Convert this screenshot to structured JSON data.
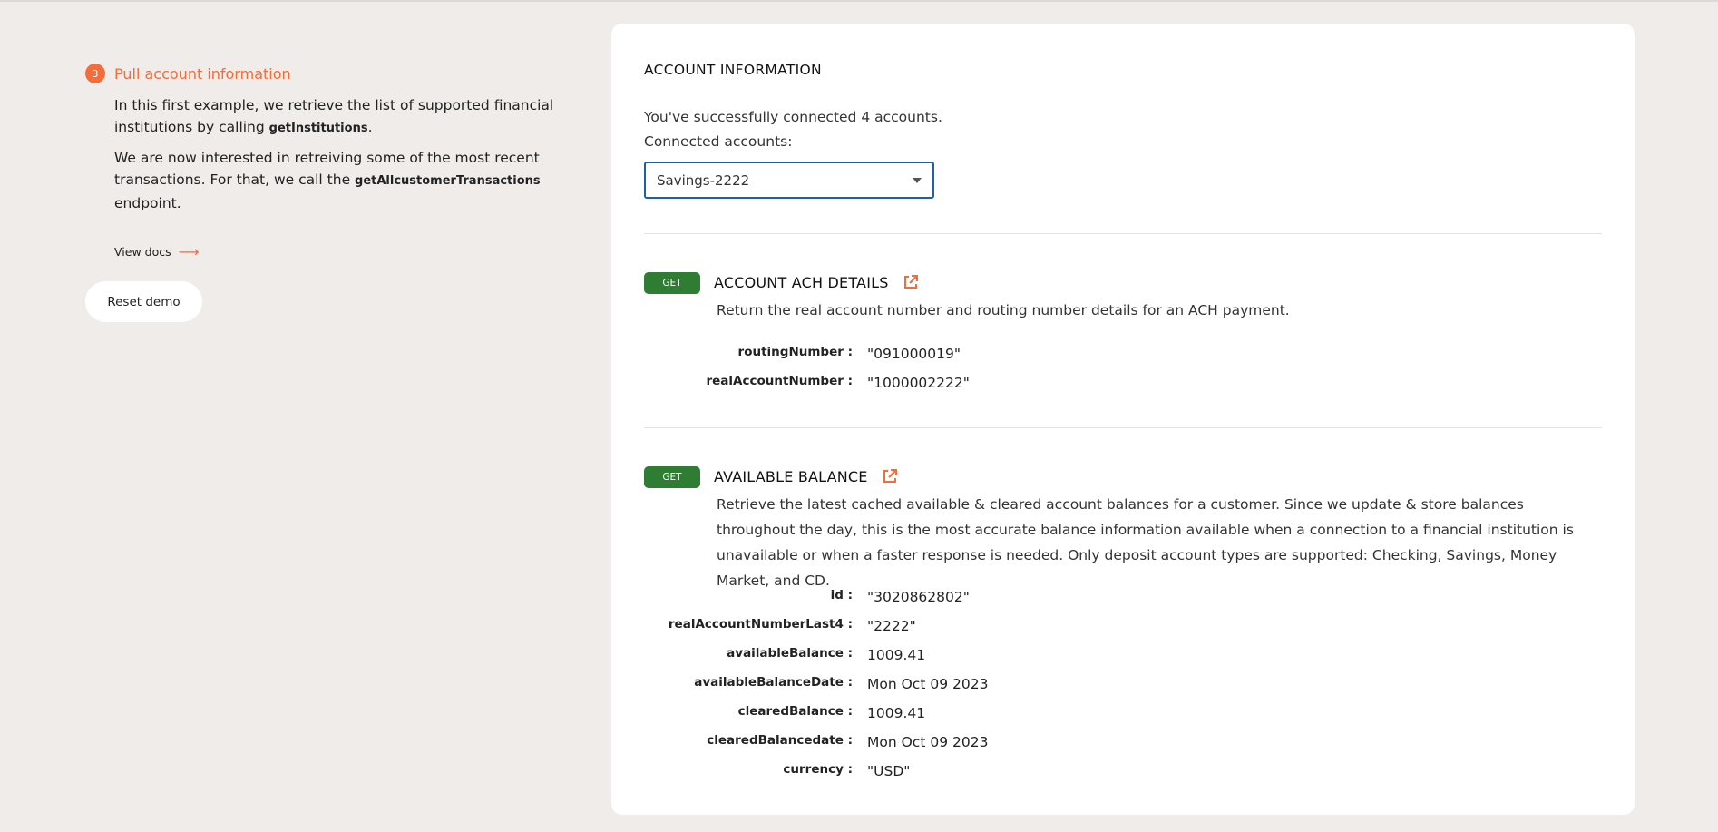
{
  "step": {
    "number": "3",
    "title": "Pull account information",
    "p1_prefix": "In this first example, we retrieve the list of supported financial institutions by calling ",
    "p1_code": "getInstitutions",
    "p1_suffix": ".",
    "p2_prefix": "We are now interested in retreiving some of the most recent transactions. For that, we call the ",
    "p2_code": "getAllcustomerTransactions",
    "p2_suffix": " endpoint.",
    "view_docs": "View docs",
    "view_docs_arrow": "⟶",
    "reset_label": "Reset demo"
  },
  "card": {
    "title": "ACCOUNT INFORMATION",
    "connected_text": "You've successfully connected 4 accounts.",
    "connected_label": "Connected accounts:",
    "selected_account": "Savings-2222"
  },
  "endpoints": [
    {
      "method": "GET",
      "title": "ACCOUNT ACH DETAILS",
      "description": "Return the real account number and routing number details for an ACH payment.",
      "fields": [
        {
          "key": "routingNumber :",
          "value": "\"091000019\""
        },
        {
          "key": "realAccountNumber :",
          "value": "\"1000002222\""
        }
      ]
    },
    {
      "method": "GET",
      "title": "AVAILABLE BALANCE",
      "description": "Retrieve the latest cached available & cleared account balances for a customer. Since we update & store balances throughout the day, this is the most accurate balance information available when a connection to a financial institution is unavailable or when a faster response is needed. Only deposit account types are supported: Checking, Savings, Money Market, and CD.",
      "fields": [
        {
          "key": "id :",
          "value": "\"3020862802\""
        },
        {
          "key": "realAccountNumberLast4 :",
          "value": "\"2222\""
        },
        {
          "key": "availableBalance :",
          "value": "1009.41"
        },
        {
          "key": "availableBalanceDate :",
          "value": "Mon Oct 09 2023"
        },
        {
          "key": "clearedBalance :",
          "value": "1009.41"
        },
        {
          "key": "clearedBalancedate :",
          "value": "Mon Oct 09 2023"
        },
        {
          "key": "currency :",
          "value": "\"USD\""
        }
      ]
    }
  ],
  "colors": {
    "accent": "#f26d3a",
    "get_badge": "#2e7d32",
    "select_border": "#1f5fa3",
    "background": "#efece9"
  },
  "icons": {
    "external_link": "external-link-icon",
    "caret": "caret-down-icon",
    "arrow": "arrow-right-icon"
  }
}
